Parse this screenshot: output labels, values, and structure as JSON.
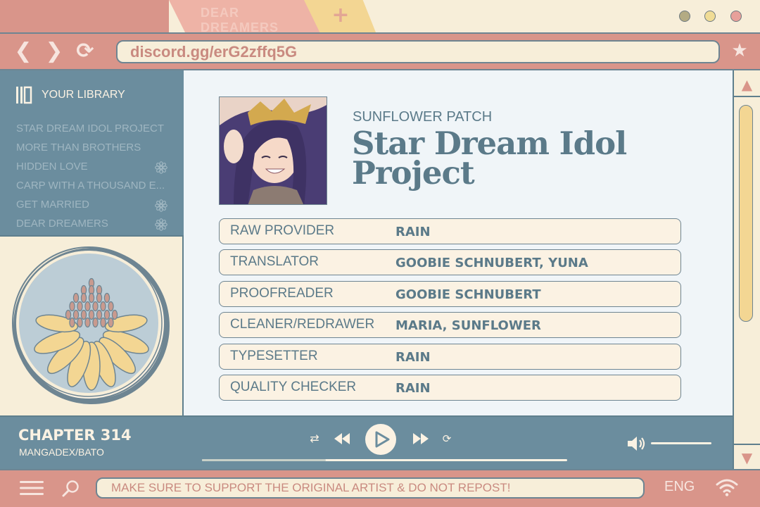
{
  "browser": {
    "tab_title": "DEAR DREAMERS",
    "new_tab_symbol": "+",
    "url": "discord.gg/erG2zffq5G"
  },
  "sidebar": {
    "title": "YOUR LIBRARY",
    "items": [
      {
        "label": "STAR DREAM IDOL PROJECT",
        "has_flower": false
      },
      {
        "label": "MORE THAN BROTHERS",
        "has_flower": false
      },
      {
        "label": "HIDDEN LOVE",
        "has_flower": true
      },
      {
        "label": "CARP WITH A THOUSAND E...",
        "has_flower": false
      },
      {
        "label": "GET MARRIED",
        "has_flower": true
      },
      {
        "label": "DEAR DREAMERS",
        "has_flower": true
      }
    ]
  },
  "main": {
    "group": "SUNFLOWER PATCH",
    "title_line1": "Star Dream Idol",
    "title_line2": "Project",
    "credits": [
      {
        "role": "RAW PROVIDER",
        "name": "RAIN"
      },
      {
        "role": "TRANSLATOR",
        "name": "GOOBIE SCHNUBERT, YUNA"
      },
      {
        "role": "PROOFREADER",
        "name": "GOOBIE SCHNUBERT"
      },
      {
        "role": "CLEANER/REDRAWER",
        "name": "MARIA, SUNFLOWER"
      },
      {
        "role": "TYPESETTER",
        "name": "RAIN"
      },
      {
        "role": "QUALITY CHECKER",
        "name": "RAIN"
      }
    ]
  },
  "player": {
    "chapter": "CHAPTER 314",
    "source": "MANGADEX/BATO",
    "progress": 0.34
  },
  "status": {
    "notice": "MAKE SURE TO SUPPORT THE ORIGINAL ARTIST & DO NOT REPOST!",
    "language": "ENG"
  },
  "colors": {
    "accent_blue": "#6b8d9e",
    "accent_pink": "#d9958a",
    "cream": "#f7eed9",
    "sunflower": "#f3d693"
  }
}
